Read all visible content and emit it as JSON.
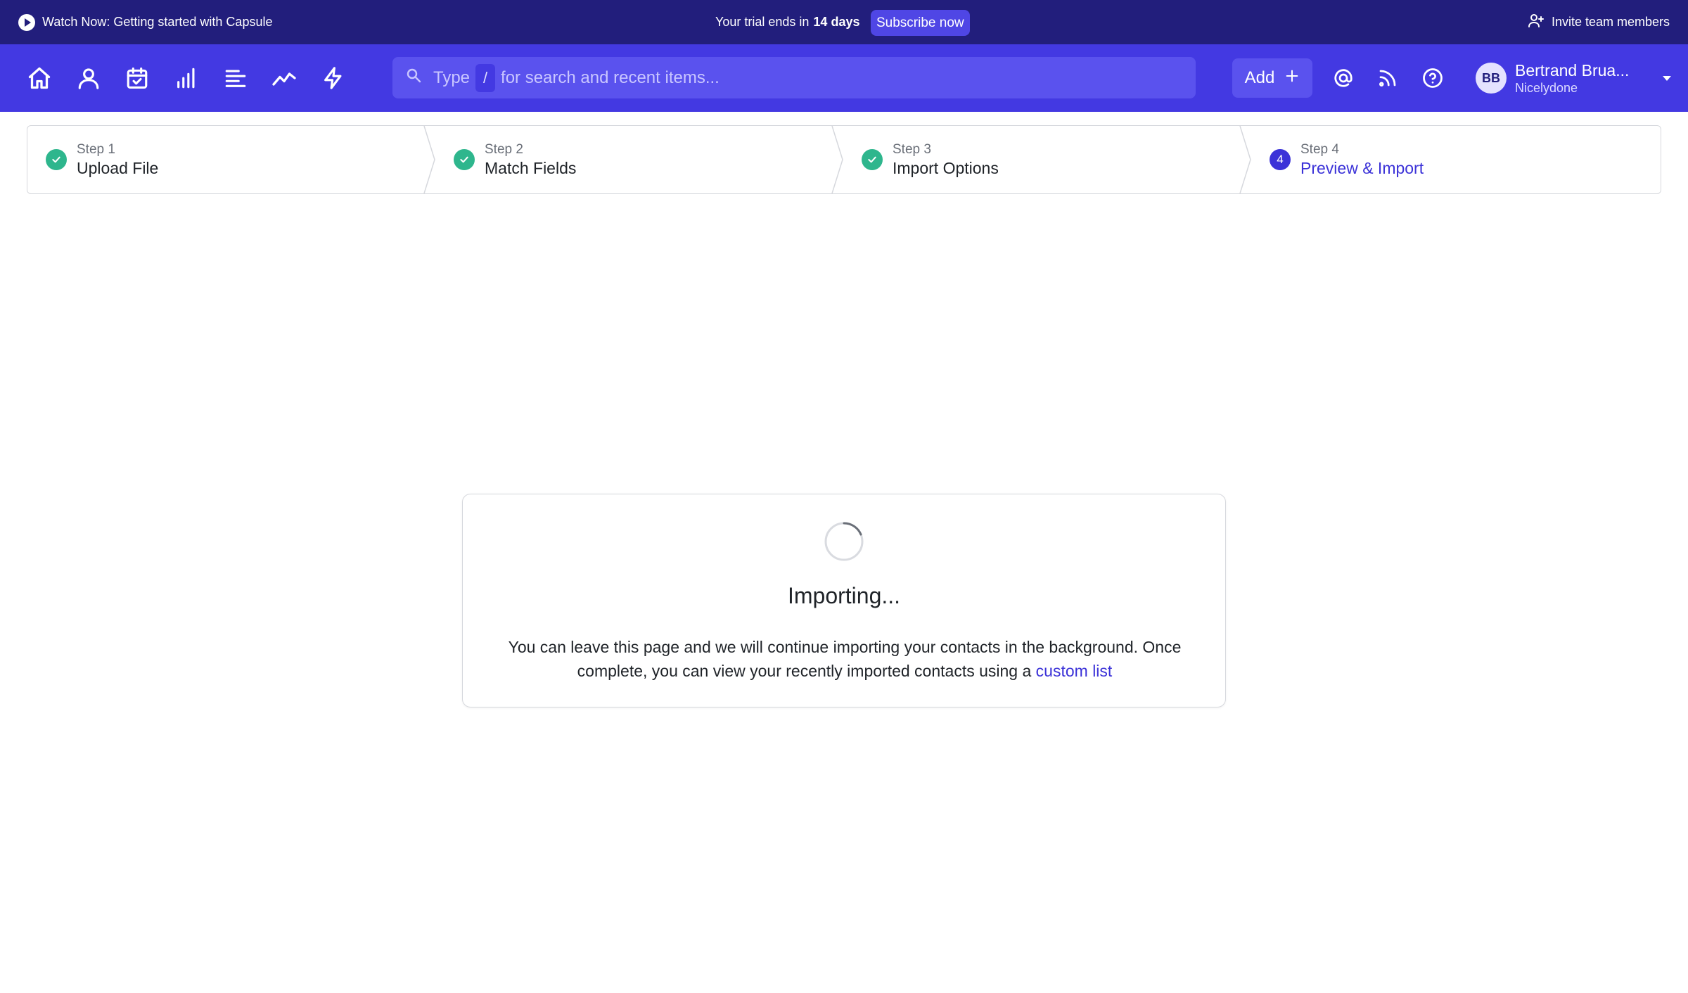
{
  "banner": {
    "watch_label": "Watch Now: Getting started with Capsule",
    "trial_prefix": "Your trial ends in",
    "trial_days": "14 days",
    "subscribe_label": "Subscribe now",
    "invite_label": "Invite team members"
  },
  "nav": {
    "icons": [
      "home-icon",
      "person-icon",
      "calendar-check-icon",
      "bar-chart-icon",
      "list-icon",
      "trend-icon",
      "lightning-icon"
    ],
    "search": {
      "prefix": "Type",
      "shortcut": "/",
      "suffix": "for search and recent items..."
    },
    "add_label": "Add",
    "right_icons": [
      "at-icon",
      "feed-icon",
      "help-icon"
    ],
    "user": {
      "initials": "BB",
      "name": "Bertrand Brua...",
      "org": "Nicelydone"
    }
  },
  "stepper": {
    "steps": [
      {
        "small": "Step 1",
        "label": "Upload File",
        "status": "done"
      },
      {
        "small": "Step 2",
        "label": "Match Fields",
        "status": "done"
      },
      {
        "small": "Step 3",
        "label": "Import Options",
        "status": "done"
      },
      {
        "small": "Step 4",
        "label": "Preview & Import",
        "status": "current",
        "number": "4"
      }
    ]
  },
  "import": {
    "title": "Importing...",
    "message_line1": "You can leave this page and we will continue importing your contacts in the background. Once",
    "message_line2": "complete, you can view your recently imported contacts using a",
    "link_label": "custom list"
  },
  "colors": {
    "banner_bg": "#221e7c",
    "nav_bg": "#4339e2",
    "accent": "#3b32d8",
    "success": "#2eb68d"
  }
}
